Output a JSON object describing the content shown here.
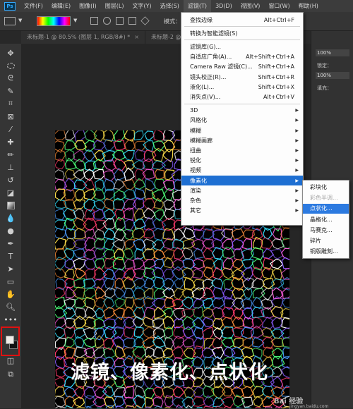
{
  "menubar": {
    "logo": "Ps",
    "items": [
      "文件(F)",
      "编辑(E)",
      "图像(I)",
      "图层(L)",
      "文字(Y)",
      "选择(S)",
      "滤镜(T)",
      "3D(D)",
      "视图(V)",
      "窗口(W)",
      "帮助(H)"
    ],
    "active_index": 6
  },
  "optionsbar": {
    "mode_label": "模式："
  },
  "doc_tabs": [
    {
      "label": "未标题-1 @ 80.5% (图层 1, RGB/8#) *",
      "close": "×"
    },
    {
      "label": "未标题-2 @",
      "close": "×"
    }
  ],
  "filter_menu": {
    "items": [
      {
        "label": "查找边缘",
        "shortcut": "Alt+Ctrl+F"
      },
      {
        "separator": true
      },
      {
        "label": "转换为智能滤镜(S)",
        "shortcut": ""
      },
      {
        "separator": true
      },
      {
        "label": "滤镜库(G)...",
        "shortcut": ""
      },
      {
        "label": "自适应广角(A)...",
        "shortcut": "Alt+Shift+Ctrl+A"
      },
      {
        "label": "Camera Raw 滤镜(C)...",
        "shortcut": "Shift+Ctrl+A"
      },
      {
        "label": "镜头校正(R)...",
        "shortcut": "Shift+Ctrl+R"
      },
      {
        "label": "液化(L)...",
        "shortcut": "Shift+Ctrl+X"
      },
      {
        "label": "消失点(V)...",
        "shortcut": "Alt+Ctrl+V"
      },
      {
        "separator": true
      },
      {
        "label": "3D",
        "submenu": true
      },
      {
        "label": "风格化",
        "submenu": true
      },
      {
        "label": "模糊",
        "submenu": true
      },
      {
        "label": "模糊画廊",
        "submenu": true
      },
      {
        "label": "扭曲",
        "submenu": true
      },
      {
        "label": "锐化",
        "submenu": true
      },
      {
        "label": "视频",
        "submenu": true
      },
      {
        "label": "像素化",
        "submenu": true,
        "highlighted": true
      },
      {
        "label": "渲染",
        "submenu": true
      },
      {
        "label": "杂色",
        "submenu": true
      },
      {
        "label": "其它",
        "submenu": true
      }
    ],
    "submenu_arrow": "▶"
  },
  "pixelate_submenu": {
    "items": [
      {
        "label": "彩块化",
        "state": "normal"
      },
      {
        "label": "彩色半调...",
        "state": "dim"
      },
      {
        "label": "点状化...",
        "state": "highlighted"
      },
      {
        "label": "晶格化...",
        "state": "normal"
      },
      {
        "label": "马赛克...",
        "state": "normal"
      },
      {
        "label": "碎片",
        "state": "normal"
      },
      {
        "label": "铜版雕刻...",
        "state": "normal"
      }
    ]
  },
  "right_panel": {
    "labels": [
      "锁定：",
      "填充："
    ],
    "values": [
      "100%",
      "100%"
    ]
  },
  "caption": "滤镜、像素化、点状化",
  "watermark": {
    "title": "Bai 经验",
    "subtitle": "jingyan.baidu.com"
  },
  "colors": {
    "highlight": "#1e6fd2",
    "foreground": "#f0ece8",
    "background": "#111111",
    "annotation": "#e01010"
  }
}
